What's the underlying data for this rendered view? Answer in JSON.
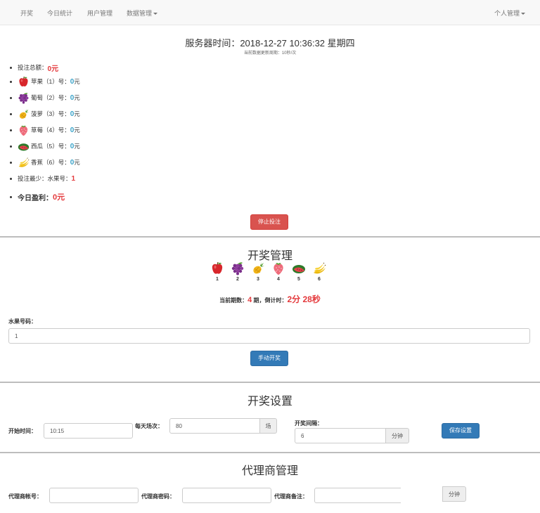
{
  "nav": {
    "items": [
      "开奖",
      "今日统计",
      "用户管理",
      "数据管理"
    ],
    "right": "个人管理"
  },
  "header": {
    "server_time": "服务器时间：2018-12-27  10:36:32  星期四",
    "refresh_note": "当前数据更新周期：10秒/次"
  },
  "bets": {
    "total_label": "投注总额：",
    "total_value": "0元",
    "fruits": [
      {
        "label": "苹果（1）号：",
        "value": "0",
        "unit": " 元",
        "icon": "apple-icon"
      },
      {
        "label": "葡萄（2）号：",
        "value": "0",
        "unit": " 元",
        "icon": "grape-icon"
      },
      {
        "label": "菠萝（3）号：",
        "value": "0",
        "unit": " 元",
        "icon": "pineapple-icon"
      },
      {
        "label": "草莓（4）号：",
        "value": "0",
        "unit": " 元",
        "icon": "strawberry-icon"
      },
      {
        "label": "西瓜（5）号：",
        "value": "0",
        "unit": " 元",
        "icon": "watermelon-icon"
      },
      {
        "label": "香蕉（6）号：",
        "value": "0",
        "unit": " 元",
        "icon": "banana-icon"
      }
    ],
    "least_label": "投注最少：水果号：",
    "least_value": "1",
    "profit_label": "今日盈利：",
    "profit_value": "0元",
    "stop_button": "停止投注"
  },
  "draw": {
    "title": "开奖管理",
    "fruit_numbers": [
      "1",
      "2",
      "3",
      "4",
      "5",
      "6"
    ],
    "period_label": "当前期数：",
    "period_value": "4",
    "period_mid": " 期，倒计时：",
    "countdown": "2分 28秒",
    "code_label": "水果号码：",
    "code_value": "1",
    "manual_button": "手动开奖"
  },
  "settings": {
    "title": "开奖设置",
    "start_label": "开始时间：",
    "start_value": "10:15",
    "daily_label": "每天场次：",
    "daily_value": "80",
    "daily_unit": "场",
    "interval_label": "开奖间隔：",
    "interval_value": "6",
    "interval_unit": "分钟",
    "save_button": "保存设置"
  },
  "agent": {
    "title": "代理商管理",
    "account_label": "代理商帐号：",
    "password_label": "代理商密码：",
    "remark_label": "代理商备注：",
    "remark_unit": "分钟"
  },
  "colors": {
    "danger": "#d9534f",
    "primary": "#337ab7",
    "red_value": "#e4393c",
    "blue_value": "#3aa3c9"
  }
}
